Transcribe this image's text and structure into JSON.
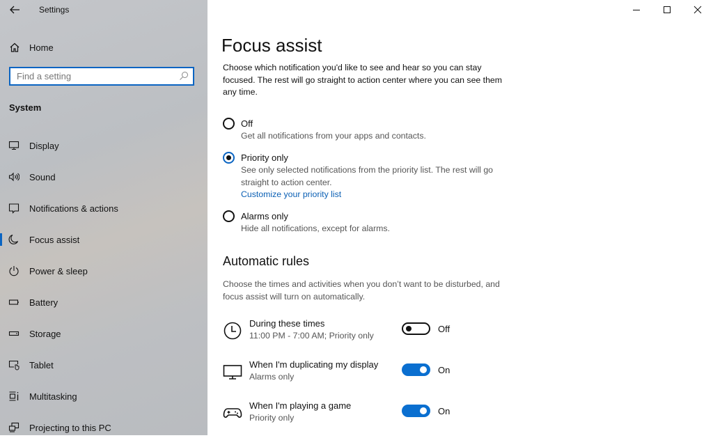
{
  "window": {
    "title": "Settings",
    "controls": [
      "minimize",
      "maximize",
      "close"
    ]
  },
  "sidebar": {
    "home_label": "Home",
    "search_placeholder": "Find a setting",
    "section_label": "System",
    "items": [
      {
        "label": "Display",
        "icon": "display-icon"
      },
      {
        "label": "Sound",
        "icon": "sound-icon"
      },
      {
        "label": "Notifications & actions",
        "icon": "notifications-icon"
      },
      {
        "label": "Focus assist",
        "icon": "moon-icon",
        "active": true
      },
      {
        "label": "Power & sleep",
        "icon": "power-icon"
      },
      {
        "label": "Battery",
        "icon": "battery-icon"
      },
      {
        "label": "Storage",
        "icon": "storage-icon"
      },
      {
        "label": "Tablet",
        "icon": "tablet-icon"
      },
      {
        "label": "Multitasking",
        "icon": "multitasking-icon"
      },
      {
        "label": "Projecting to this PC",
        "icon": "projecting-icon"
      }
    ]
  },
  "main": {
    "title": "Focus assist",
    "description": "Choose which notification you'd like to see and hear so you can stay focused. The rest will go straight to action center where you can see them any time.",
    "options": [
      {
        "label": "Off",
        "description": "Get all notifications from your apps and contacts.",
        "selected": false
      },
      {
        "label": "Priority only",
        "description": "See only selected notifications from the priority list. The rest will go straight to action center.",
        "link": "Customize your priority list",
        "selected": true
      },
      {
        "label": "Alarms only",
        "description": "Hide all notifications, except for alarms.",
        "selected": false
      }
    ],
    "rules_title": "Automatic rules",
    "rules_description": "Choose the times and activities when you don’t want to be disturbed, and focus assist will turn on automatically.",
    "rules": [
      {
        "title": "During these times",
        "subtitle": "11:00 PM - 7:00 AM; Priority only",
        "state": "Off",
        "on": false,
        "icon": "clock-icon"
      },
      {
        "title": "When I'm duplicating my display",
        "subtitle": "Alarms only",
        "state": "On",
        "on": true,
        "icon": "monitor-icon"
      },
      {
        "title": "When I'm playing a game",
        "subtitle": "Priority only",
        "state": "On",
        "on": true,
        "icon": "gamepad-icon"
      }
    ]
  },
  "colors": {
    "accent": "#0a6fd0",
    "link": "#0a5fb4"
  }
}
